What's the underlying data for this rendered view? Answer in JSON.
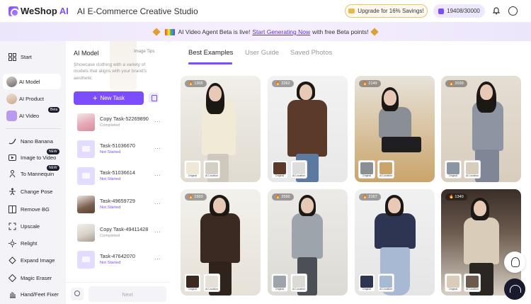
{
  "header": {
    "logo": "WeShop",
    "logo_ai": "AI",
    "title": "AI E-Commerce Creative Studio",
    "upgrade": "Upgrade for 16% Savings!",
    "credits": "19408/30000"
  },
  "banner": {
    "prefix": "AI Video Agent Beta is live!",
    "link": "Start Generating Now",
    "suffix": "with free Beta points!"
  },
  "nav": {
    "items": [
      {
        "label": "Start",
        "icon": "grid-icon"
      },
      {
        "label": "AI Model",
        "icon": "model-avatar-icon",
        "active": true
      },
      {
        "label": "AI Product",
        "icon": "product-avatar-icon"
      },
      {
        "label": "AI Video",
        "icon": "video-icon",
        "badge": "Beta"
      },
      {
        "label": "Nano Banana",
        "icon": "banana-icon"
      },
      {
        "label": "Image to Video",
        "icon": "play-icon",
        "badge": "NEW"
      },
      {
        "label": "To Mannequin",
        "icon": "mannequin-icon",
        "badge": "NEW"
      },
      {
        "label": "Change Pose",
        "icon": "pose-icon"
      },
      {
        "label": "Remove BG",
        "icon": "remove-bg-icon"
      },
      {
        "label": "Upscale",
        "icon": "upscale-icon"
      },
      {
        "label": "Relight",
        "icon": "relight-icon"
      },
      {
        "label": "Expand Image",
        "icon": "expand-icon"
      },
      {
        "label": "Magic Eraser",
        "icon": "eraser-icon"
      },
      {
        "label": "Hand/Feet Fixer",
        "icon": "hand-icon"
      }
    ]
  },
  "panel": {
    "title": "AI Model",
    "tips": "Image Tips",
    "description": "Showcase clothing with a variety of models that aligns with your brand's aesthetic",
    "new_task": "New Task",
    "next": "Next",
    "tasks": [
      {
        "name": "Copy Task-52269890",
        "status": "Completed",
        "thumb": "img1"
      },
      {
        "name": "Task-51036670",
        "status": "Not Started",
        "thumb": "ph"
      },
      {
        "name": "Task-51036614",
        "status": "Not Started",
        "thumb": "ph"
      },
      {
        "name": "Task-49659729",
        "status": "Not Started",
        "thumb": "img2"
      },
      {
        "name": "Copy Task-49411428",
        "status": "Completed",
        "thumb": "img3"
      },
      {
        "name": "Task-47642070",
        "status": "Not Started",
        "thumb": "ph"
      }
    ]
  },
  "main": {
    "tabs": [
      "Best Examples",
      "User Guide",
      "Saved Photos"
    ],
    "mini_labels": {
      "original": "Original",
      "location": "AI Location"
    },
    "cards": [
      {
        "likes": "1305"
      },
      {
        "likes": "2262"
      },
      {
        "likes": "2149"
      },
      {
        "likes": "2039"
      },
      {
        "likes": "1503"
      },
      {
        "likes": "2590"
      },
      {
        "likes": "2167"
      },
      {
        "likes": "1340"
      }
    ]
  },
  "colors": {
    "accent": "#7c4dff",
    "dark": "#1a1a2e"
  }
}
